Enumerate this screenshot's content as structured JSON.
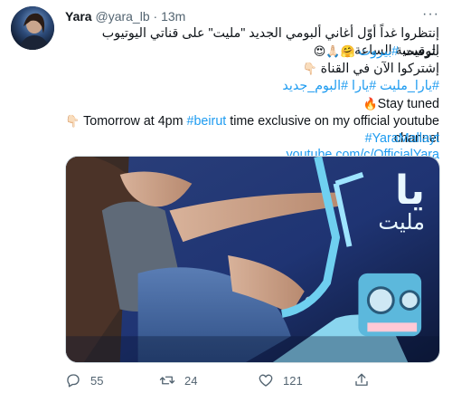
{
  "author": {
    "name": "Yara",
    "handle": "@yara_lb",
    "separator": "·",
    "time": "13m"
  },
  "more_label": "···",
  "tweet": {
    "line1": "إنتظروا غداً أوّل أغاني ألبومي الجديد \"مليت\" على قناتي اليوتيوب الرسمية الساعة ٤",
    "line2_text": "بتوقيت",
    "line2_hashtag": "#بيروت",
    "line2_emoji": "🤗🙏🏻😍",
    "line3_text": "إشتركوا الآن في القناة",
    "line3_emoji": "👇🏻",
    "line4_hashtags": "#يارا_مليت #يارا #البوم_جديد",
    "line5_text": "Stay tuned",
    "line5_emoji": "🔥",
    "line6_emoji": "👇🏻",
    "line6_before": "Tomorrow at 4pm ",
    "line6_hashtag": "#beirut",
    "line6_after": " time exclusive on my official youtube channel",
    "line7_hashtag": "#YaraMallayt",
    "line8_link": "youtube.com/c/OfficialYara"
  },
  "media": {
    "title_big": "يا",
    "title_small": "مليت"
  },
  "actions": {
    "reply_count": "55",
    "retweet_count": "24",
    "like_count": "121"
  },
  "colors": {
    "link": "#1d9bf0",
    "muted": "#536471",
    "text": "#0f1419"
  }
}
